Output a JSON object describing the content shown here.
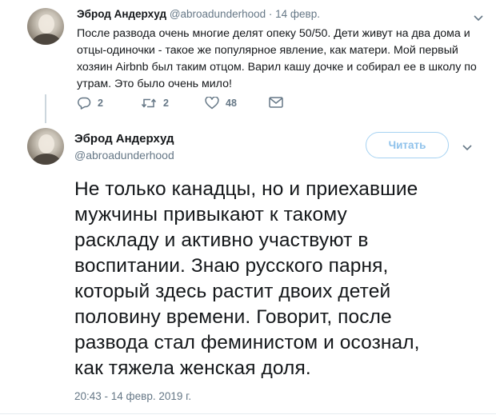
{
  "colors": {
    "text": "#14171a",
    "muted": "#657786",
    "accent": "#1da1f2",
    "follow_border": "#a6d2f2"
  },
  "tweet1": {
    "name": "Эброд Андерхуд",
    "handle": "@abroadunderhood",
    "separator": "·",
    "date": "14 февр.",
    "lines": [
      "После развода очень многие делят опеку 50/50. Дети живут на два дома и",
      "отцы-одиночки - такое же популярное явление, как матери. Мой первый",
      "хозяин Airbnb был таким отцом. Варил кашу дочке и собирал ее в школу по",
      "утрам. Это было очень мило!"
    ],
    "actions": {
      "reply_count": "2",
      "retweet_count": "2",
      "like_count": "48",
      "icons": [
        "reply-icon",
        "retweet-icon",
        "heart-icon",
        "mail-icon"
      ]
    }
  },
  "tweet2": {
    "name": "Эброд Андерхуд",
    "handle": "@abroadunderhood",
    "follow_label": "Читать",
    "lines": [
      "Не только канадцы, но и приехавшие",
      "мужчины привыкают к такому",
      "раскладу и активно участвуют в",
      "воспитании. Знаю русского парня,",
      "который здесь растит двоих детей",
      "половину времени. Говорит, после",
      "развода стал феминистом и осознал,",
      "как тяжела женская доля."
    ],
    "timestamp": "20:43 - 14 февр. 2019 г."
  }
}
